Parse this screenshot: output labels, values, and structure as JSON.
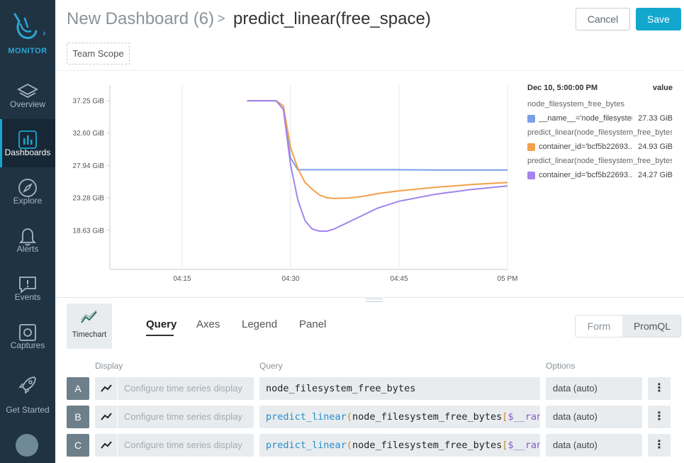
{
  "sidebar": {
    "brand": "MONITOR",
    "items": [
      {
        "label": "Overview",
        "icon": "layers-icon"
      },
      {
        "label": "Dashboards",
        "icon": "bar-chart-icon",
        "active": true
      },
      {
        "label": "Explore",
        "icon": "compass-icon"
      },
      {
        "label": "Alerts",
        "icon": "bell-icon"
      },
      {
        "label": "Events",
        "icon": "chat-alert-icon"
      },
      {
        "label": "Captures",
        "icon": "capture-icon"
      },
      {
        "label": "Get Started",
        "icon": "rocket-icon"
      }
    ]
  },
  "header": {
    "breadcrumb": "New Dashboard (6)",
    "separator": ">",
    "title": "predict_linear(free_space)",
    "cancel_label": "Cancel",
    "save_label": "Save",
    "scope_label": "Team Scope"
  },
  "colors": {
    "accent": "#13a7cd",
    "series_blue": "#7b9fe8",
    "series_orange": "#f2a04a",
    "series_purple": "#a184ee"
  },
  "chart_data": {
    "type": "line",
    "title": "",
    "xlabel": "",
    "ylabel": "",
    "x_ticks": [
      "04:15",
      "04:30",
      "04:45",
      "05 PM"
    ],
    "y_ticks": [
      "37.25 GiB",
      "32.60 GiB",
      "27.94 GiB",
      "23.28 GiB",
      "18.63 GiB"
    ],
    "ylim_gib": [
      13.0,
      39.5
    ],
    "x_minutes_range": [
      "04:05",
      "05:00"
    ],
    "grid": "vertical",
    "legend_position": "right",
    "series": [
      {
        "name": "__name__='node_filesystem_free_bytes'",
        "color": "#7b9fe8",
        "x": [
          "04:24",
          "04:26",
          "04:28",
          "04:29",
          "04:30",
          "04:31",
          "04:35",
          "04:40",
          "04:45",
          "04:50",
          "04:55",
          "05:00"
        ],
        "y": [
          37.25,
          37.25,
          37.25,
          36.0,
          29.0,
          27.33,
          27.33,
          27.33,
          27.33,
          27.3,
          27.3,
          27.3
        ]
      },
      {
        "name": "container_id='bcf5b22693...'",
        "color": "#f2a04a",
        "x": [
          "04:24",
          "04:26",
          "04:28",
          "04:29",
          "04:30",
          "04:31",
          "04:32",
          "04:33",
          "04:34",
          "04:35",
          "04:36",
          "04:38",
          "04:40",
          "04:42",
          "04:45",
          "04:50",
          "04:55",
          "05:00"
        ],
        "y": [
          37.25,
          37.25,
          37.25,
          36.5,
          30.5,
          27.5,
          25.5,
          24.5,
          23.7,
          23.3,
          23.2,
          23.25,
          23.5,
          23.9,
          24.3,
          24.8,
          25.2,
          25.5
        ]
      },
      {
        "name": "container_id='bcf5b22693...'",
        "color": "#a184ee",
        "x": [
          "04:24",
          "04:26",
          "04:28",
          "04:29",
          "04:30",
          "04:31",
          "04:32",
          "04:33",
          "04:34",
          "04:35",
          "04:36",
          "04:38",
          "04:40",
          "04:42",
          "04:45",
          "04:50",
          "04:55",
          "05:00"
        ],
        "y": [
          37.25,
          37.25,
          37.25,
          36.0,
          28.0,
          23.0,
          20.0,
          18.8,
          18.5,
          18.5,
          18.8,
          19.8,
          20.8,
          21.8,
          22.8,
          23.8,
          24.5,
          25.0
        ]
      }
    ]
  },
  "legend": {
    "timestamp": "Dec 10, 5:00:00 PM",
    "value_header": "value",
    "groups": [
      {
        "query": "node_filesystem_free_bytes",
        "label": "__name__='node_filesystem_free_bytes'",
        "value": "27.33 GiB",
        "color": "#7b9fe8"
      },
      {
        "query": "predict_linear(node_filesystem_free_bytes[$__range])",
        "label": "container_id='bcf5b22693...'",
        "value": "24.93 GiB",
        "color": "#f2a04a"
      },
      {
        "query": "predict_linear(node_filesystem_free_bytes[$__range])",
        "label": "container_id='bcf5b22693...'",
        "value": "24.27 GiB",
        "color": "#a184ee"
      }
    ]
  },
  "editor": {
    "chart_type_label": "Timechart",
    "tabs": [
      "Query",
      "Axes",
      "Legend",
      "Panel"
    ],
    "mode_form": "Form",
    "mode_promql": "PromQL",
    "col_display": "Display",
    "col_query": "Query",
    "col_options": "Options",
    "rows": [
      {
        "letter": "A",
        "display_placeholder": "Configure time series display",
        "query_fn": "",
        "query_paren": "",
        "query_metric": "node_filesystem_free_bytes",
        "query_bracket": "",
        "query_var": "",
        "options": "data (auto)"
      },
      {
        "letter": "B",
        "display_placeholder": "Configure time series display",
        "query_fn": "predict_linear",
        "query_paren": "(",
        "query_metric": "node_filesystem_free_bytes",
        "query_bracket": "[",
        "query_var": "$__range",
        "options": "data (auto)"
      },
      {
        "letter": "C",
        "display_placeholder": "Configure time series display",
        "query_fn": "predict_linear",
        "query_paren": "(",
        "query_metric": "node_filesystem_free_bytes",
        "query_bracket": "[",
        "query_var": "$__range",
        "options": "data (auto)"
      }
    ]
  }
}
